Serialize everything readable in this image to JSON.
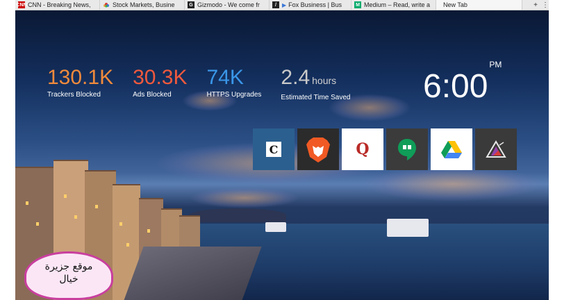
{
  "browser": {
    "tabs": [
      {
        "label": "CNN - Breaking News,",
        "favicon": "cnn-icon"
      },
      {
        "label": "Stock Markets, Busine",
        "favicon": "nbc-peacock-icon"
      },
      {
        "label": "Gizmodo - We come fr",
        "favicon": "gizmodo-g-icon"
      },
      {
        "label": "Fox Business | Bus",
        "favicon": "fox-business-icon"
      },
      {
        "label": "Medium – Read, write a",
        "favicon": "medium-m-icon"
      },
      {
        "label": "New Tab",
        "favicon": ""
      }
    ],
    "new_tab_symbol": "+",
    "menu_symbol": "⋮"
  },
  "stats": [
    {
      "value": "130.1K",
      "unit": "",
      "label": "Trackers Blocked",
      "color": "#f08a3c"
    },
    {
      "value": "30.3K",
      "unit": "",
      "label": "Ads Blocked",
      "color": "#f0593d"
    },
    {
      "value": "74K",
      "unit": "",
      "label": "HTTPS Upgrades",
      "color": "#3a96e8"
    },
    {
      "value": "2.4",
      "unit": "hours",
      "label": "Estimated Time Saved",
      "color": "#c9c9c9"
    }
  ],
  "clock": {
    "time": "6:00",
    "period": "PM"
  },
  "top_sites": [
    {
      "name": "chronicle-icon",
      "glyph": "C",
      "bg": "#2b5f8f"
    },
    {
      "name": "brave-lion-icon",
      "glyph": "",
      "bg": "#2b2b2b"
    },
    {
      "name": "quora-icon",
      "glyph": "Q",
      "bg": "#ffffff"
    },
    {
      "name": "hangouts-icon",
      "glyph": "",
      "bg": "#3b3b3b"
    },
    {
      "name": "google-drive-icon",
      "glyph": "",
      "bg": "#ffffff"
    },
    {
      "name": "prism-icon",
      "glyph": "",
      "bg": "#3a3a3a"
    }
  ],
  "watermark": {
    "line1": "موقع جزيرة",
    "line2": "خيال"
  }
}
